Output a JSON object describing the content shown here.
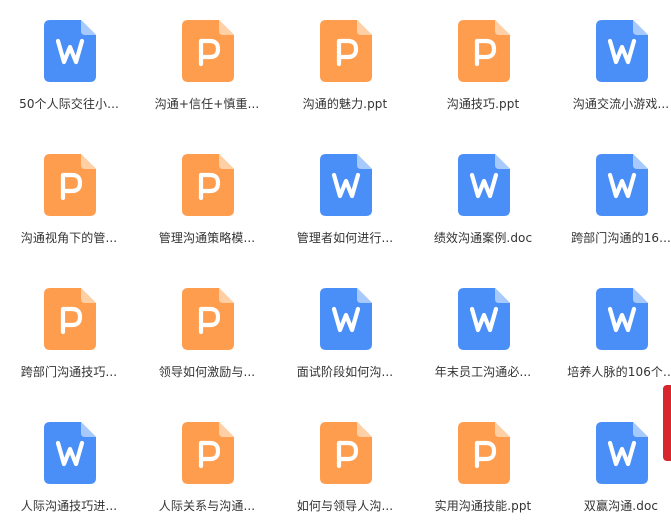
{
  "colors": {
    "word": "#4a8ff7",
    "word_fold": "#a8c9fb",
    "ppt": "#ff9d4f",
    "ppt_fold": "#ffcfa6",
    "badge": "#d9262c"
  },
  "files": [
    {
      "name": "50个人际交往小...",
      "type": "word",
      "icon": "word-doc-icon",
      "glyph": "W"
    },
    {
      "name": "沟通+信任+慎重...",
      "type": "ppt",
      "icon": "ppt-doc-icon",
      "glyph": "P"
    },
    {
      "name": "沟通的魅力.ppt",
      "type": "ppt",
      "icon": "ppt-doc-icon",
      "glyph": "P"
    },
    {
      "name": "沟通技巧.ppt",
      "type": "ppt",
      "icon": "ppt-doc-icon",
      "glyph": "P"
    },
    {
      "name": "沟通交流小游戏...",
      "type": "word",
      "icon": "word-doc-icon",
      "glyph": "W"
    },
    {
      "name": "沟通视角下的管...",
      "type": "ppt",
      "icon": "ppt-doc-icon",
      "glyph": "P"
    },
    {
      "name": "管理沟通策略模...",
      "type": "ppt",
      "icon": "ppt-doc-icon",
      "glyph": "P"
    },
    {
      "name": "管理者如何进行...",
      "type": "word",
      "icon": "word-doc-icon",
      "glyph": "W"
    },
    {
      "name": "绩效沟通案例.doc",
      "type": "word",
      "icon": "word-doc-icon",
      "glyph": "W"
    },
    {
      "name": "跨部门沟通的16...",
      "type": "word",
      "icon": "word-doc-icon",
      "glyph": "W"
    },
    {
      "name": "跨部门沟通技巧...",
      "type": "ppt",
      "icon": "ppt-doc-icon",
      "glyph": "P"
    },
    {
      "name": "领导如何激励与...",
      "type": "ppt",
      "icon": "ppt-doc-icon",
      "glyph": "P"
    },
    {
      "name": "面试阶段如何沟...",
      "type": "word",
      "icon": "word-doc-icon",
      "glyph": "W"
    },
    {
      "name": "年末员工沟通必...",
      "type": "word",
      "icon": "word-doc-icon",
      "glyph": "W"
    },
    {
      "name": "培养人脉的106个...",
      "type": "word",
      "icon": "word-doc-icon",
      "glyph": "W"
    },
    {
      "name": "人际沟通技巧进...",
      "type": "word",
      "icon": "word-doc-icon",
      "glyph": "W"
    },
    {
      "name": "人际关系与沟通...",
      "type": "ppt",
      "icon": "ppt-doc-icon",
      "glyph": "P"
    },
    {
      "name": "如何与领导人沟...",
      "type": "ppt",
      "icon": "ppt-doc-icon",
      "glyph": "P"
    },
    {
      "name": "实用沟通技能.ppt",
      "type": "ppt",
      "icon": "ppt-doc-icon",
      "glyph": "P"
    },
    {
      "name": "双赢沟通.doc",
      "type": "word",
      "icon": "word-doc-icon",
      "glyph": "W"
    }
  ]
}
